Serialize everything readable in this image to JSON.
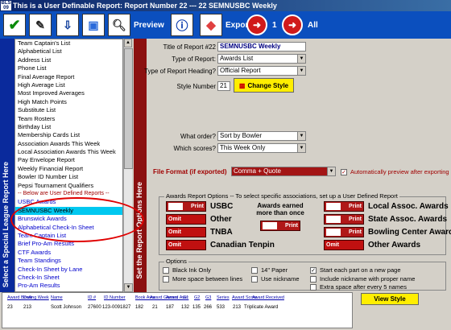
{
  "window": {
    "title": "This is a User Definable Report: Report Number 22  ---  22 SEMNUSBC Weekly",
    "app_icon": "BLS\n2009"
  },
  "toolbar": {
    "preview": "Preview",
    "export": "Export",
    "nav_one": "1",
    "nav_all": "All"
  },
  "left_panel": {
    "vertical_title": "Select a Special League Report Here",
    "items": [
      {
        "label": "Team Captain's List",
        "style": "normal"
      },
      {
        "label": "Alphabetical List",
        "style": "normal"
      },
      {
        "label": "Address List",
        "style": "normal"
      },
      {
        "label": "Phone List",
        "style": "normal"
      },
      {
        "label": "Final Average Report",
        "style": "normal"
      },
      {
        "label": "High Average List",
        "style": "normal"
      },
      {
        "label": "Most Improved Averages",
        "style": "normal"
      },
      {
        "label": "High Match Points",
        "style": "normal"
      },
      {
        "label": "Substitute List",
        "style": "normal"
      },
      {
        "label": "Team Rosters",
        "style": "normal"
      },
      {
        "label": "Birthday List",
        "style": "normal"
      },
      {
        "label": "Membership Cards List",
        "style": "normal"
      },
      {
        "label": "Association Awards This Week",
        "style": "normal"
      },
      {
        "label": "Local Association Awards This Week",
        "style": "normal"
      },
      {
        "label": "Pay Envelope Report",
        "style": "normal"
      },
      {
        "label": "Weekly Financial Report",
        "style": "normal"
      },
      {
        "label": "Bowler ID Number List",
        "style": "normal"
      },
      {
        "label": "Pepsi Tournament Qualifiers",
        "style": "normal"
      },
      {
        "label": "-- Below are User Defined Reports --",
        "style": "dash"
      },
      {
        "label": "USBC Awards",
        "style": "blue"
      },
      {
        "label": "SEMNUSBC Weekly",
        "style": "selected"
      },
      {
        "label": "Brunswick Awards",
        "style": "blue"
      },
      {
        "label": "Alphabetical Check-In Sheet",
        "style": "blue"
      },
      {
        "label": "Team Captain List",
        "style": "blue"
      },
      {
        "label": "Brief Pro-Am Results",
        "style": "blue"
      },
      {
        "label": "CTF Awards",
        "style": "blue"
      },
      {
        "label": "Team Standings",
        "style": "blue"
      },
      {
        "label": "Check-In Sheet by Lane",
        "style": "blue"
      },
      {
        "label": "Check-In Sheet",
        "style": "blue"
      },
      {
        "label": "Pro-Am Results",
        "style": "blue"
      }
    ]
  },
  "options_panel": {
    "vertical_title": "Set the Report Options Here",
    "title_label": "Title of Report #22",
    "title_value": "SEMNUSBC Weekly",
    "type_label": "Type of Report:",
    "type_value": "Awards List",
    "heading_label": "Type of Report Heading?",
    "heading_value": "Official Report",
    "style_label": "Style Number",
    "style_value": "21",
    "change_style": "Change Style",
    "order_label": "What order?",
    "order_value": "Sort by Bowler",
    "scores_label": "Which scores?",
    "scores_value": "This Week Only",
    "file_format_label": "File Format (if exported)",
    "file_format_value": "Comma + Quote",
    "auto_preview": "Automatically preview after exporting",
    "auto_preview_checked": "✓"
  },
  "awards": {
    "caption": "Awards Report Options -- To select specific associations, set up a User Defined Report",
    "print": "Print",
    "omit": "Omit",
    "usbc": "USBC",
    "other": "Other",
    "tnba": "TNBA",
    "canadian": "Canadian Tenpin",
    "more_than_once": "Awards earned more than once",
    "local_assoc": "Local Assoc. Awards",
    "state_assoc": "State Assoc. Awards",
    "bowling_center": "Bowling Center Awards",
    "other_awards": "Other Awards"
  },
  "options": {
    "caption": "Options",
    "black_ink": "Black Ink Only",
    "more_space": "More space between lines",
    "paper14": "14\" Paper",
    "use_nickname": "Use nickname",
    "new_page": "Start each part on a new page",
    "include_nickname": "Include nickname with proper name",
    "extra_space": "Extra space after every 5 names",
    "new_page_checked": "✓"
  },
  "view_style": "View Style",
  "preview_table": {
    "headers": [
      "Award Bowling Week",
      "Date",
      "Name",
      "ID #",
      "ID Number",
      "Book Aver",
      "Award Games",
      "Award Aver",
      "G1",
      "G2",
      "G3",
      "Series",
      "Award Score",
      "Award Received"
    ],
    "row": [
      "23",
      "213",
      "Scott Johnson",
      "27600",
      "123-0091827",
      "182",
      "21",
      "187",
      "132",
      "135",
      "266",
      "533",
      "213",
      "Triplicate Award"
    ]
  }
}
